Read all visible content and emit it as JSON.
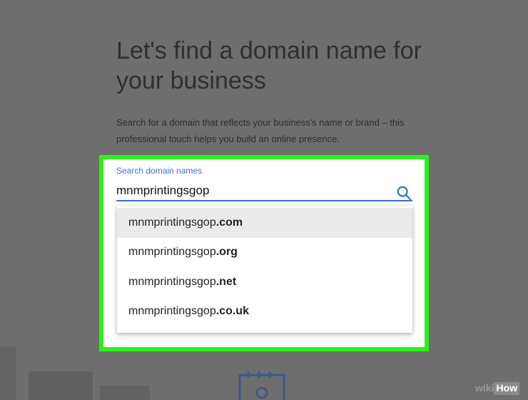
{
  "page": {
    "heading": "Let's find a domain name for your business",
    "description": "Search for a domain that reflects your business's name or brand – this professional touch helps you build an online presence."
  },
  "search": {
    "label": "Search domain names",
    "value": "mnmprintingsgop",
    "icon": "search-icon"
  },
  "suggestions": [
    {
      "base": "mnmprintingsgop",
      "tld": ".com",
      "highlighted": true
    },
    {
      "base": "mnmprintingsgop",
      "tld": ".org",
      "highlighted": false
    },
    {
      "base": "mnmprintingsgop",
      "tld": ".net",
      "highlighted": false
    },
    {
      "base": "mnmprintingsgop",
      "tld": ".co.uk",
      "highlighted": false
    }
  ],
  "watermark": {
    "wiki": "wiki",
    "how": "How"
  },
  "colors": {
    "highlight": "#2cf01a",
    "accent": "#3d6fdc",
    "overlay": "#6e6e6e"
  }
}
